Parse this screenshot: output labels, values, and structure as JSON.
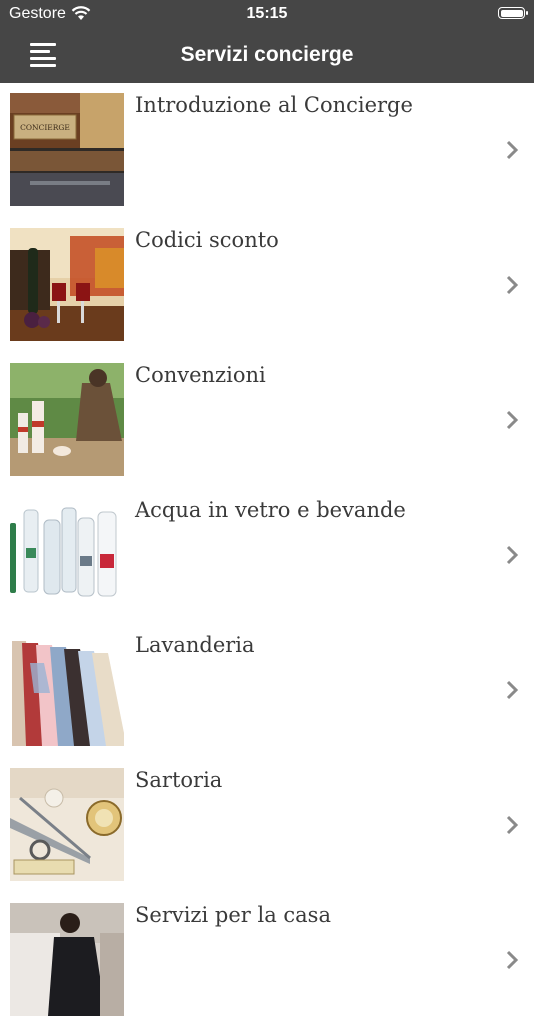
{
  "status_bar": {
    "carrier": "Gestore",
    "time": "15:15"
  },
  "header": {
    "title": "Servizi concierge",
    "menu_icon": "hamburger-menu-icon"
  },
  "list": {
    "items": [
      {
        "label": "Introduzione al Concierge",
        "thumb_text": "CONCIERGE"
      },
      {
        "label": "Codici sconto"
      },
      {
        "label": "Convenzioni"
      },
      {
        "label": "Acqua in vetro e bevande"
      },
      {
        "label": "Lavanderia"
      },
      {
        "label": "Sartoria"
      },
      {
        "label": "Servizi per la casa"
      }
    ],
    "chevron_icon": "chevron-right-icon"
  }
}
